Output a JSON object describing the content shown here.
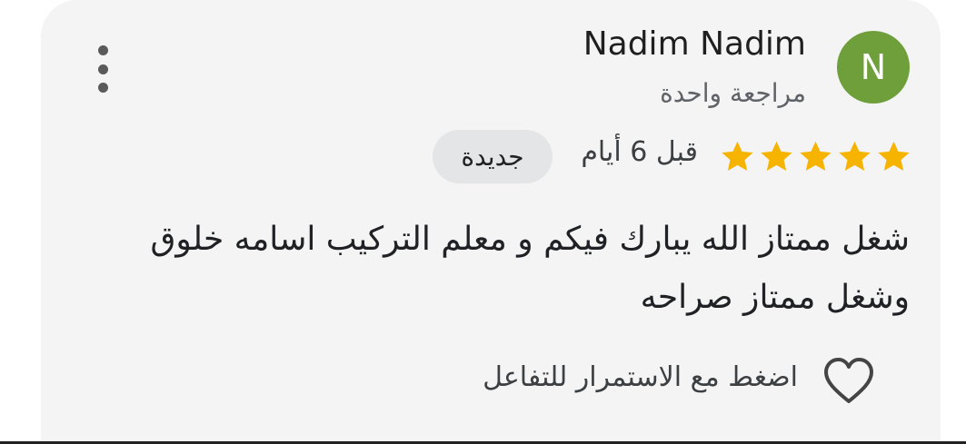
{
  "review": {
    "author": {
      "name": "Nadim Nadim",
      "avatar_initial": "N",
      "avatar_color": "#6f9f3a",
      "reviews_count": "مراجعة واحدة"
    },
    "menu_icon": "more-vert-icon",
    "rating": 5,
    "rating_max": 5,
    "star_color": "#f6b400",
    "time": "قبل 6 أيام",
    "badge": "جديدة",
    "text": "شغل ممتاز الله يبارك فيكم و معلم التركيب اسامه خلوق وشغل ممتاز صراحه",
    "interaction": {
      "icon": "heart-icon",
      "label": "اضغط مع الاستمرار للتفاعل"
    }
  }
}
